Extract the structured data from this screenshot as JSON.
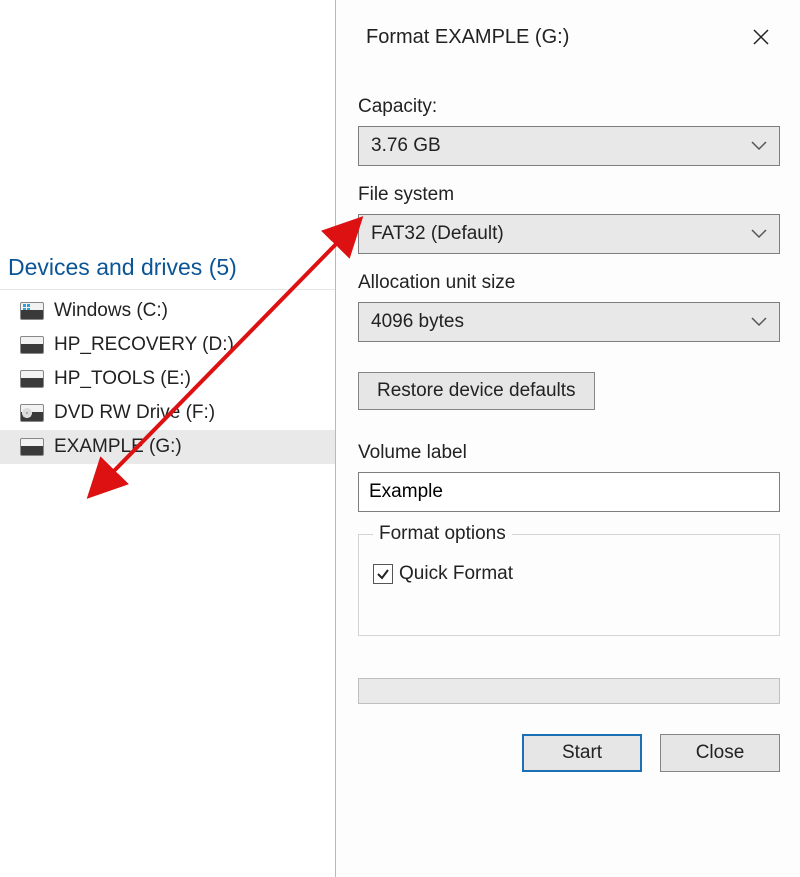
{
  "explorer": {
    "section_title": "Devices and drives (5)",
    "drives": [
      {
        "label": "Windows (C:)"
      },
      {
        "label": "HP_RECOVERY (D:)"
      },
      {
        "label": "HP_TOOLS (E:)"
      },
      {
        "label": "DVD RW Drive (F:)"
      },
      {
        "label": "EXAMPLE (G:)"
      }
    ]
  },
  "dialog": {
    "title": "Format EXAMPLE (G:)",
    "capacity_label": "Capacity:",
    "capacity_value": "3.76 GB",
    "filesystem_label": "File system",
    "filesystem_value": "FAT32 (Default)",
    "allocation_label": "Allocation unit size",
    "allocation_value": "4096 bytes",
    "restore_defaults": "Restore device defaults",
    "volume_label_label": "Volume label",
    "volume_label_value": "Example",
    "format_options_label": "Format options",
    "quick_format_label": "Quick Format",
    "start": "Start",
    "close": "Close"
  }
}
